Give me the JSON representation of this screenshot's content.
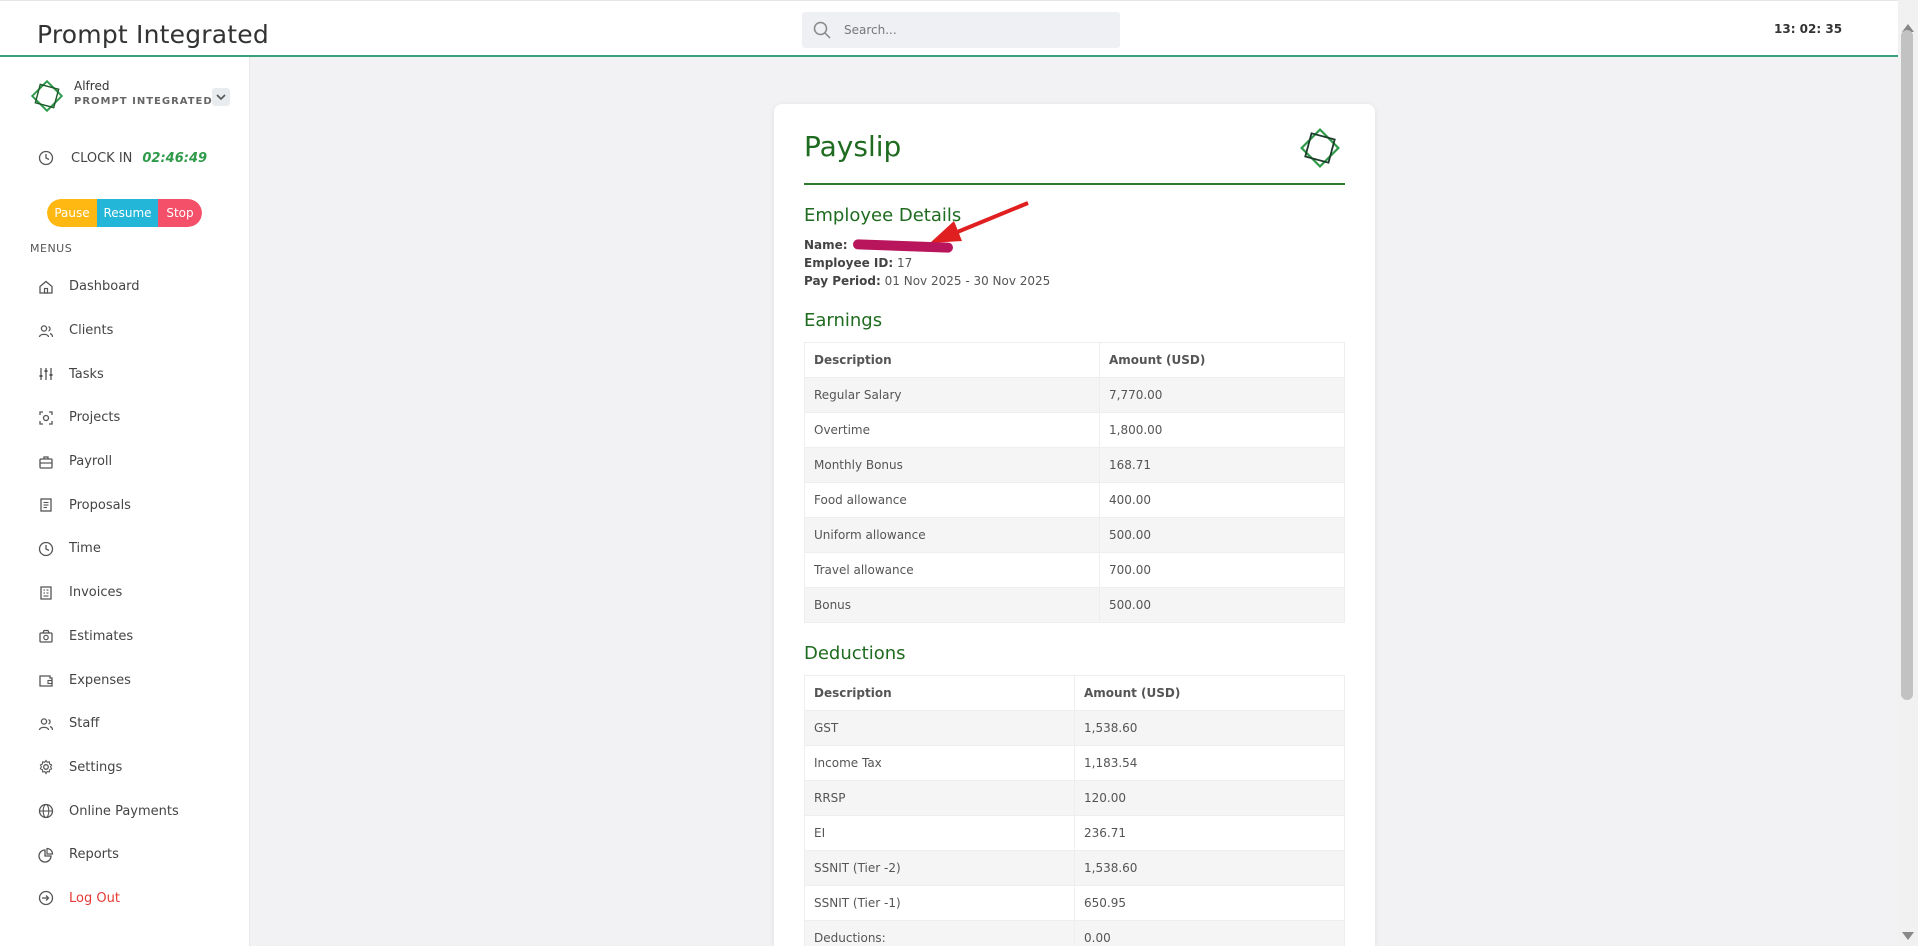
{
  "header": {
    "app_title": "Prompt Integrated",
    "search_placeholder": "Search...",
    "clock": "13: 02: 35"
  },
  "sidebar": {
    "user": {
      "name": "Alfred",
      "org": "PROMPT INTEGRATED"
    },
    "clock_in": {
      "label": "CLOCK IN",
      "timer": "02:46:49"
    },
    "timer_buttons": {
      "pause": "Pause",
      "resume": "Resume",
      "stop": "Stop"
    },
    "menus_label": "MENUS",
    "items": [
      {
        "label": "Dashboard",
        "icon": "home-icon"
      },
      {
        "label": "Clients",
        "icon": "users-icon"
      },
      {
        "label": "Tasks",
        "icon": "sliders-icon"
      },
      {
        "label": "Projects",
        "icon": "projects-icon"
      },
      {
        "label": "Payroll",
        "icon": "briefcase-icon"
      },
      {
        "label": "Proposals",
        "icon": "document-icon"
      },
      {
        "label": "Time",
        "icon": "clock-icon"
      },
      {
        "label": "Invoices",
        "icon": "invoice-icon"
      },
      {
        "label": "Estimates",
        "icon": "estimate-icon"
      },
      {
        "label": "Expenses",
        "icon": "wallet-icon"
      },
      {
        "label": "Staff",
        "icon": "staff-icon"
      },
      {
        "label": "Settings",
        "icon": "gear-icon"
      },
      {
        "label": "Online Payments",
        "icon": "globe-icon"
      },
      {
        "label": "Reports",
        "icon": "pie-chart-icon"
      },
      {
        "label": "Log Out",
        "icon": "logout-icon"
      }
    ]
  },
  "payslip": {
    "title": "Payslip",
    "employee_details": {
      "heading": "Employee Details",
      "name_label": "Name:",
      "employee_id_label": "Employee ID:",
      "employee_id": "17",
      "pay_period_label": "Pay Period:",
      "pay_period": "01 Nov 2025 - 30 Nov 2025"
    },
    "earnings": {
      "heading": "Earnings",
      "col_description": "Description",
      "col_amount": "Amount (USD)",
      "rows": [
        {
          "description": "Regular Salary",
          "amount": "7,770.00"
        },
        {
          "description": "Overtime",
          "amount": "1,800.00"
        },
        {
          "description": "Monthly Bonus",
          "amount": "168.71"
        },
        {
          "description": "Food allowance",
          "amount": "400.00"
        },
        {
          "description": "Uniform allowance",
          "amount": "500.00"
        },
        {
          "description": "Travel allowance",
          "amount": "700.00"
        },
        {
          "description": "Bonus",
          "amount": "500.00"
        }
      ]
    },
    "deductions": {
      "heading": "Deductions",
      "col_description": "Description",
      "col_amount": "Amount (USD)",
      "rows": [
        {
          "description": "GST",
          "amount": "1,538.60"
        },
        {
          "description": "Income Tax",
          "amount": "1,183.54"
        },
        {
          "description": "RRSP",
          "amount": "120.00"
        },
        {
          "description": "EI",
          "amount": "236.71"
        },
        {
          "description": "SSNIT (Tier -2)",
          "amount": "1,538.60"
        },
        {
          "description": "SSNIT (Tier -1)",
          "amount": "650.95"
        },
        {
          "description": "Deductions:",
          "amount": "0.00"
        }
      ]
    }
  },
  "colors": {
    "brand_green": "#1f6b1f",
    "header_rule": "#3aa07a",
    "pause": "#ffb811",
    "resume": "#23b6d8",
    "stop": "#f4506a",
    "logout": "#e53935",
    "redaction": "#b8155c",
    "arrow": "#e02020"
  }
}
